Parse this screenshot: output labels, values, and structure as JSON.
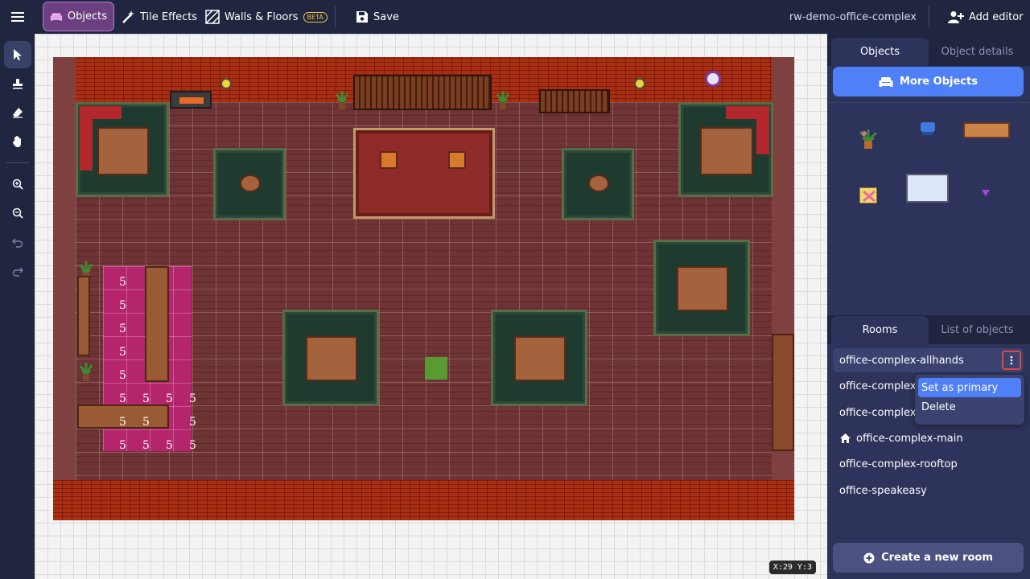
{
  "topbar": {
    "menu_icon": "hamburger-icon",
    "objects_label": "Objects",
    "tile_effects_label": "Tile Effects",
    "walls_floors_label": "Walls & Floors",
    "beta_badge": "BETA",
    "save_label": "Save",
    "map_name": "rw-demo-office-complex",
    "add_editor_label": "Add editor"
  },
  "left_tools": [
    {
      "name": "select-tool",
      "icon": "cursor-arrow-icon",
      "active": true
    },
    {
      "name": "stamp-tool",
      "icon": "stamp-icon",
      "active": false
    },
    {
      "name": "eraser-tool",
      "icon": "eraser-icon",
      "active": false
    },
    {
      "name": "hand-tool",
      "icon": "hand-icon",
      "active": false
    },
    {
      "name": "zoom-in",
      "icon": "zoom-in-icon",
      "active": false
    },
    {
      "name": "zoom-out",
      "icon": "zoom-out-icon",
      "active": false
    },
    {
      "name": "undo",
      "icon": "undo-icon",
      "active": false
    },
    {
      "name": "redo",
      "icon": "redo-icon",
      "active": false
    }
  ],
  "canvas": {
    "coordinates": "X:29  Y:3",
    "lounge_numbers": [
      "5",
      "5",
      "5",
      "5",
      "5",
      "5",
      "5",
      "5",
      "5",
      "5",
      "5",
      "5",
      "5",
      "5",
      "5",
      "5"
    ]
  },
  "panel": {
    "objects_tab": "Objects",
    "object_details_tab": "Object details",
    "more_objects_label": "More Objects",
    "rooms_tab": "Rooms",
    "list_of_objects_tab": "List of objects",
    "rooms": [
      {
        "name": "office-complex-allhands",
        "selected": true
      },
      {
        "name": "office-complex-",
        "selected": false
      },
      {
        "name": "office-complex-",
        "selected": false
      },
      {
        "name": "office-complex-main",
        "primary": true
      },
      {
        "name": "office-complex-rooftop",
        "selected": false
      },
      {
        "name": "office-speakeasy",
        "selected": false
      }
    ],
    "context_menu": {
      "set_primary": "Set as primary",
      "delete": "Delete"
    },
    "create_room_label": "Create a new room"
  },
  "colors": {
    "background": "#202540",
    "panel": "#2d335a",
    "accent_blue": "#4f80f8",
    "active_objects_tab": "#6b3f80",
    "highlight_red": "#e0463f"
  }
}
